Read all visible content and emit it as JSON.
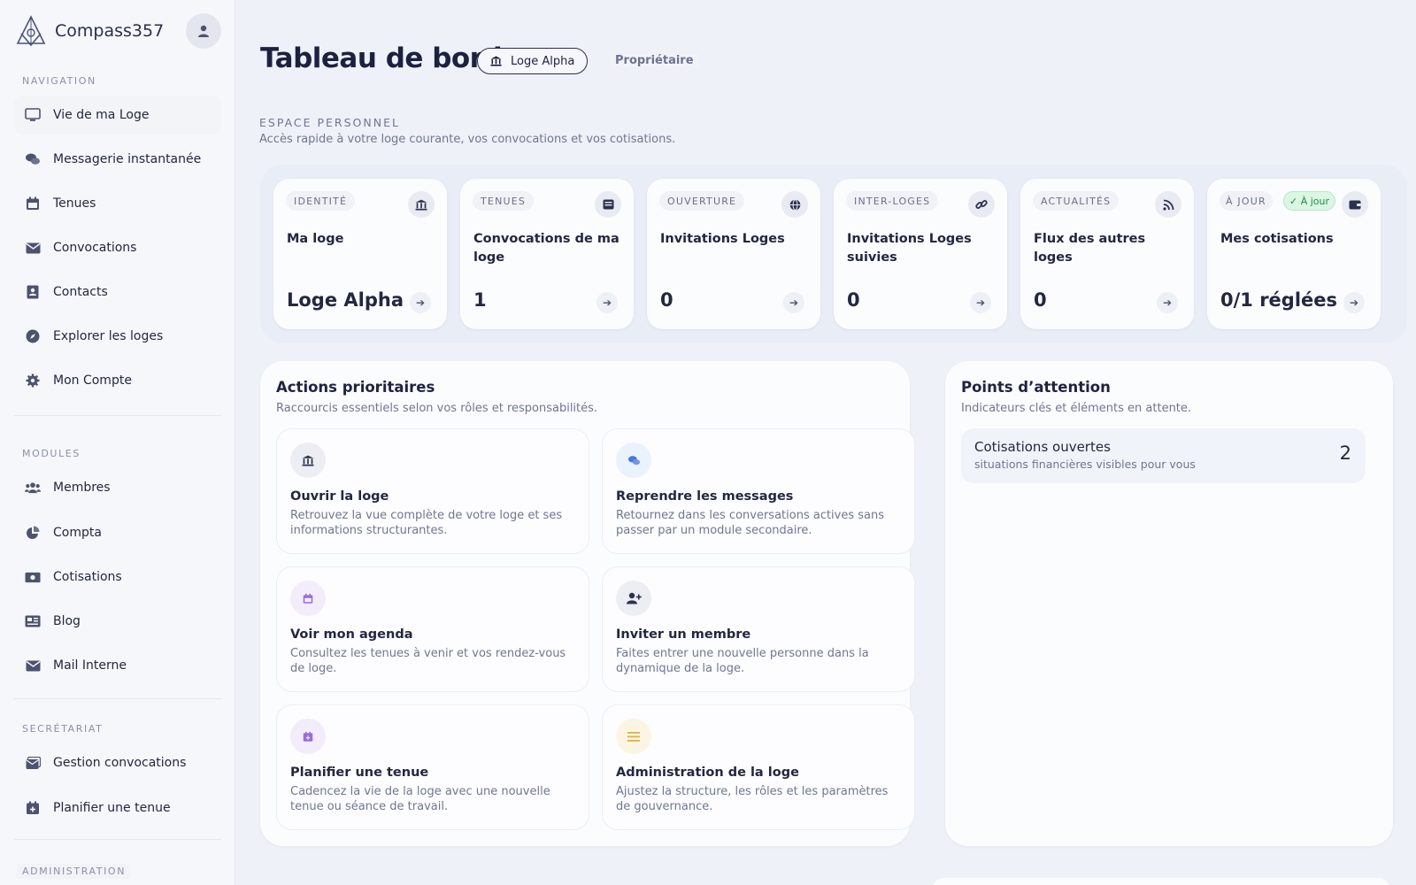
{
  "brand": {
    "name": "Compass357"
  },
  "sidebar": {
    "sections": {
      "navigation": "NAVIGATION",
      "modules": "MODULES",
      "secretariat": "SECRÉTARIAT",
      "administration": "ADMINISTRATION"
    },
    "nav": [
      {
        "label": "Vie de ma Loge",
        "icon": "monitor-icon"
      },
      {
        "label": "Messagerie instantanée",
        "icon": "chat-icon"
      },
      {
        "label": "Tenues",
        "icon": "calendar-icon"
      },
      {
        "label": "Convocations",
        "icon": "envelope-icon"
      },
      {
        "label": "Contacts",
        "icon": "contact-card-icon"
      },
      {
        "label": "Explorer les loges",
        "icon": "compass-icon"
      },
      {
        "label": "Mon Compte",
        "icon": "gear-icon"
      }
    ],
    "modules": [
      {
        "label": "Membres",
        "icon": "users-icon"
      },
      {
        "label": "Compta",
        "icon": "pie-chart-icon"
      },
      {
        "label": "Cotisations",
        "icon": "money-icon"
      },
      {
        "label": "Blog",
        "icon": "newspaper-icon"
      },
      {
        "label": "Mail Interne",
        "icon": "envelope-icon"
      }
    ],
    "secretariat": [
      {
        "label": "Gestion convocations",
        "icon": "mail-bulk-icon"
      },
      {
        "label": "Planifier une tenue",
        "icon": "calendar-plus-icon"
      }
    ]
  },
  "header": {
    "title": "Tableau de bord",
    "loge_pill": "Loge Alpha",
    "role": "Propriétaire"
  },
  "espace": {
    "title": "ESPACE PERSONNEL",
    "subtitle": "Accès rapide à votre loge courante, vos convocations et vos cotisations."
  },
  "cards": [
    {
      "tag": "IDENTITÉ",
      "title": "Ma loge",
      "value": "Loge Alpha",
      "icon": "bank-icon"
    },
    {
      "tag": "TENUES",
      "title": "Convocations de ma loge",
      "value": "1",
      "icon": "mail-bulk-icon"
    },
    {
      "tag": "OUVERTURE",
      "title": "Invitations Loges",
      "value": "0",
      "icon": "globe-icon"
    },
    {
      "tag": "INTER-LOGES",
      "title": "Invitations Loges suivies",
      "value": "0",
      "icon": "link-icon"
    },
    {
      "tag": "ACTUALITÉS",
      "title": "Flux des autres loges",
      "value": "0",
      "icon": "rss-icon"
    },
    {
      "tag": "À JOUR",
      "badge": "✓ À jour",
      "title": "Mes cotisations",
      "value": "0/1 réglées",
      "icon": "wallet-icon"
    }
  ],
  "actions": {
    "title": "Actions prioritaires",
    "subtitle": "Raccourcis essentiels selon vos rôles et responsabilités.",
    "items": [
      {
        "title": "Ouvrir la loge",
        "desc": "Retrouvez la vue complète de votre loge et ses informations structurantes.",
        "icon": "bank-icon"
      },
      {
        "title": "Reprendre les messages",
        "desc": "Retournez dans les conversations actives sans passer par un module secondaire.",
        "icon": "chat-icon"
      },
      {
        "title": "Voir mon agenda",
        "desc": "Consultez les tenues à venir et vos rendez-vous de loge.",
        "icon": "calendar-icon"
      },
      {
        "title": "Inviter un membre",
        "desc": "Faites entrer une nouvelle personne dans la dynamique de la loge.",
        "icon": "user-plus-icon"
      },
      {
        "title": "Planifier une tenue",
        "desc": "Cadencez la vie de la loge avec une nouvelle tenue ou séance de travail.",
        "icon": "calendar-plus-icon"
      },
      {
        "title": "Administration de la loge",
        "desc": "Ajustez la structure, les rôles et les paramètres de gouvernance.",
        "icon": "list-icon"
      }
    ]
  },
  "attention": {
    "title": "Points d’attention",
    "subtitle": "Indicateurs clés et éléments en attente.",
    "items": [
      {
        "title": "Cotisations ouvertes",
        "desc": "situations financières visibles pour vous",
        "count": "2"
      }
    ]
  },
  "colors": {
    "ink": "#1f2340",
    "muted": "#70768f",
    "card_bg": "#fbfcfe",
    "ok_green": "#1e8a4a",
    "ok_green_bg": "#dcf6e4",
    "icon_blue": "#4a78d8",
    "icon_purple": "#9b6bd6",
    "icon_gold": "#e0b040"
  }
}
